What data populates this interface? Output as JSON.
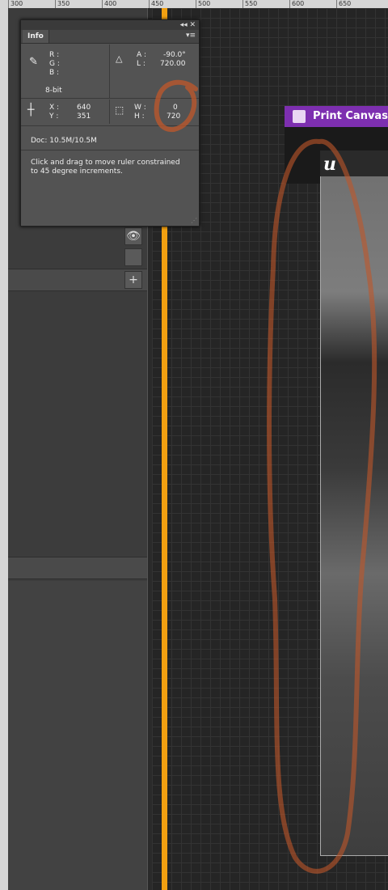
{
  "ruler": {
    "ticks": [
      "300",
      "350",
      "400",
      "450",
      "500",
      "550",
      "600",
      "650"
    ]
  },
  "info_panel": {
    "collapse_glyph": "◂◂ ✕",
    "tab_label": "Info",
    "menu_glyph": "▾≡",
    "rgb": {
      "r_label": "R :",
      "g_label": "G :",
      "b_label": "B :"
    },
    "bit_depth": "8-bit",
    "angle": {
      "a_label": "A :",
      "a_value": "-90.0°",
      "l_label": "L :",
      "l_value": "720.00"
    },
    "position": {
      "x_label": "X :",
      "x_value": "640",
      "y_label": "Y :",
      "y_value": "351"
    },
    "size": {
      "w_label": "W :",
      "w_value": "0",
      "h_label": "H :",
      "h_value": "720"
    },
    "doc": "Doc: 10.5M/10.5M",
    "hint": "Click and drag to move ruler constrained to 45 degree increments."
  },
  "ue_window": {
    "title": "Print Canvas R"
  },
  "panel_icons": {
    "eye": "👁",
    "plus": "+"
  },
  "colors": {
    "guide": "#f2a011",
    "ue_title_bar": "#7d2fb0",
    "scribble": "#c0572a"
  }
}
